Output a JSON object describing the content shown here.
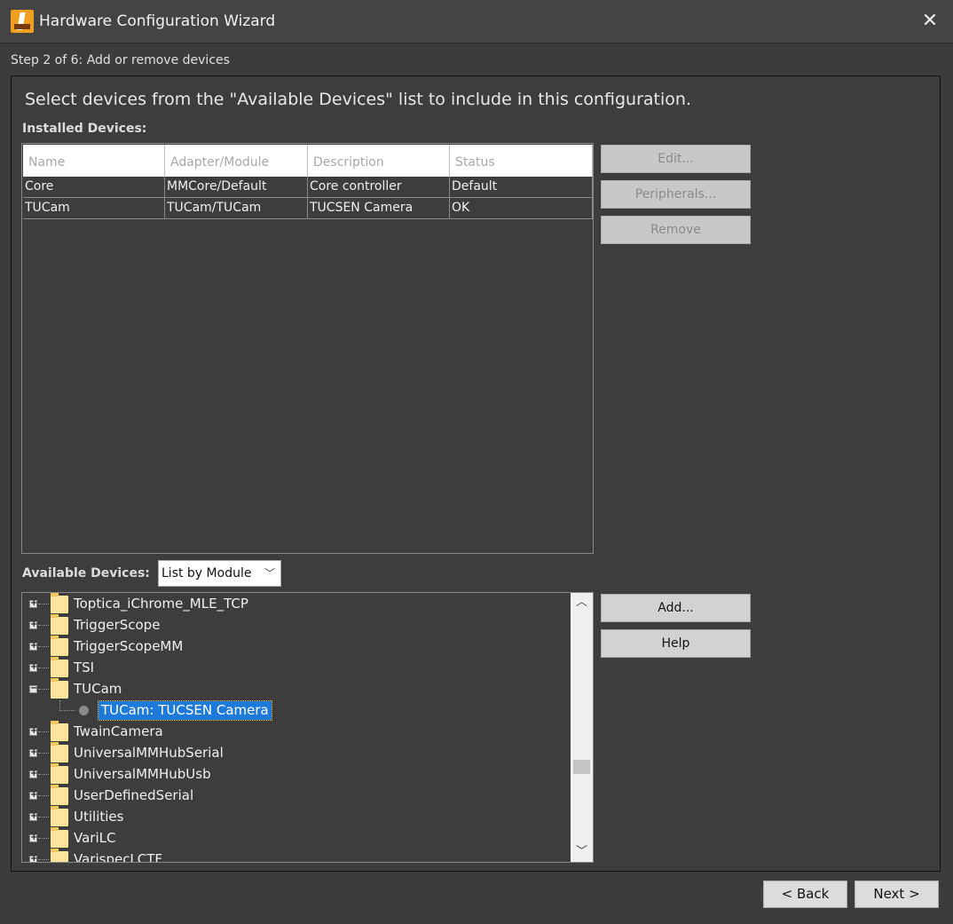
{
  "window": {
    "title": "Hardware Configuration Wizard",
    "step_label": "Step 2 of 6: Add or remove devices",
    "instructions": "Select devices from the \"Available Devices\" list to include in this configuration."
  },
  "installed": {
    "label": "Installed Devices:",
    "columns": [
      "Name",
      "Adapter/Module",
      "Description",
      "Status"
    ],
    "rows": [
      [
        "Core",
        "MMCore/Default",
        "Core controller",
        "Default"
      ],
      [
        "TUCam",
        "TUCam/TUCam",
        "TUCSEN Camera",
        "OK"
      ]
    ],
    "buttons": {
      "edit": "Edit...",
      "peripherals": "Peripherals...",
      "remove": "Remove"
    }
  },
  "available": {
    "label": "Available Devices:",
    "view_mode": "List by Module",
    "tree": [
      {
        "label": "Toptica_iChrome_MLE_TCP",
        "expanded": false
      },
      {
        "label": "TriggerScope",
        "expanded": false
      },
      {
        "label": "TriggerScopeMM",
        "expanded": false
      },
      {
        "label": "TSI",
        "expanded": false
      },
      {
        "label": "TUCam",
        "expanded": true
      },
      {
        "child": "TUCam: TUCSEN Camera",
        "selected": true
      },
      {
        "label": "TwainCamera",
        "expanded": false
      },
      {
        "label": "UniversalMMHubSerial",
        "expanded": false
      },
      {
        "label": "UniversalMMHubUsb",
        "expanded": false
      },
      {
        "label": "UserDefinedSerial",
        "expanded": false
      },
      {
        "label": "Utilities",
        "expanded": false
      },
      {
        "label": "VariLC",
        "expanded": false
      },
      {
        "label": "VarispecLCTF",
        "expanded": false
      }
    ],
    "buttons": {
      "add": "Add...",
      "help": "Help"
    }
  },
  "nav": {
    "back": "< Back",
    "next": "Next >"
  },
  "colors": {
    "background": "#3c3c3c",
    "selection": "#1e7ad8",
    "folder": "#fce59a"
  }
}
